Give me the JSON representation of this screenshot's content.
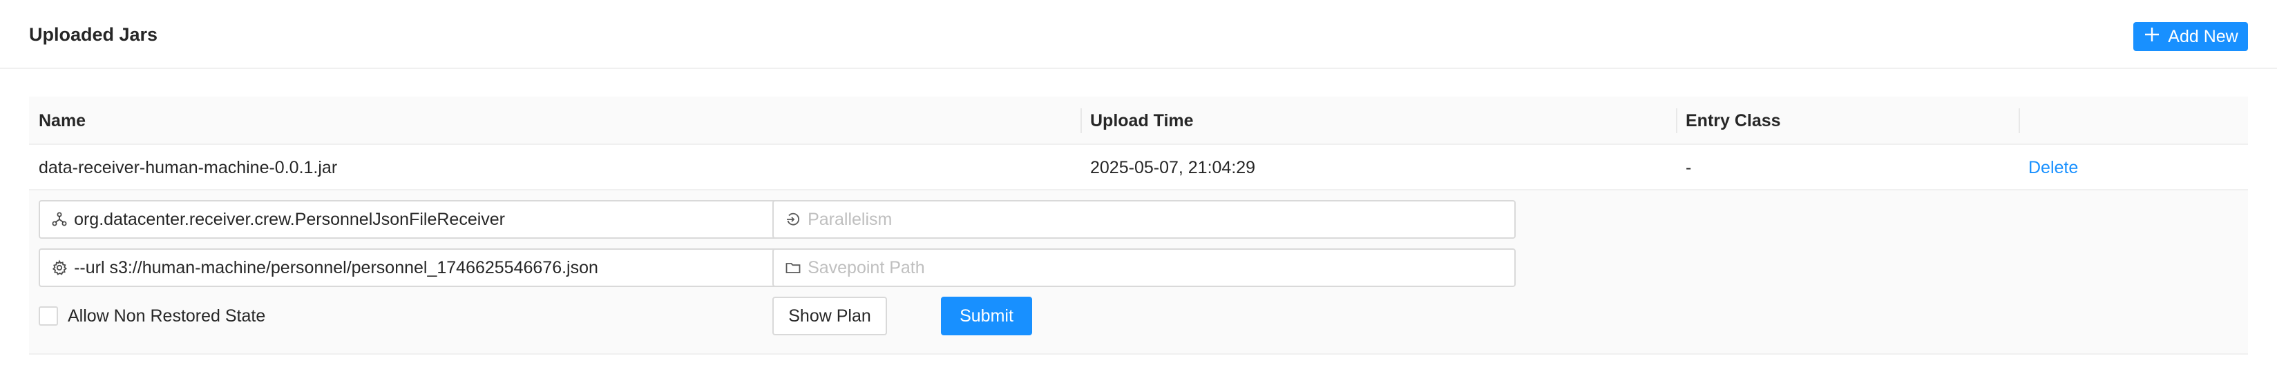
{
  "card": {
    "title": "Uploaded Jars",
    "add_button_label": "Add New"
  },
  "table": {
    "columns": [
      "Name",
      "Upload Time",
      "Entry Class",
      ""
    ],
    "rows": [
      {
        "name": "data-receiver-human-machine-0.0.1.jar",
        "upload_time": "2025-05-07, 21:04:29",
        "entry_class": "-",
        "action": "Delete"
      }
    ]
  },
  "submit_form": {
    "entry_class_value": "org.datacenter.receiver.crew.PersonnelJsonFileReceiver",
    "program_args_value": "--url s3://human-machine/personnel/personnel_1746625546676.json",
    "parallelism_placeholder": "Parallelism",
    "savepoint_placeholder": "Savepoint Path",
    "allow_non_restored_label": "Allow Non Restored State",
    "allow_non_restored_checked": false,
    "show_plan_label": "Show Plan",
    "submit_label": "Submit"
  },
  "colors": {
    "primary": "#1890ff",
    "header_bg": "#fafafa",
    "border": "#d9d9d9"
  },
  "icons": {
    "add": "plus-icon",
    "entry_class": "cluster-icon",
    "program_args": "gear-icon",
    "parallelism": "login-icon",
    "savepoint": "folder-icon"
  }
}
